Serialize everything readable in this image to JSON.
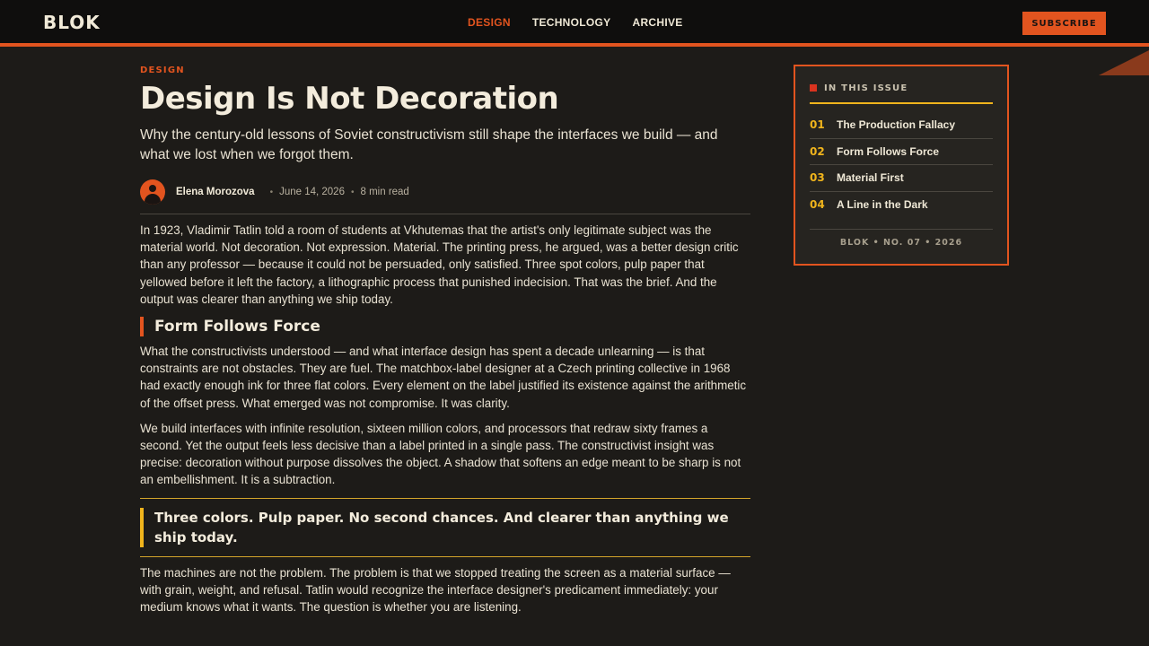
{
  "header": {
    "logo": "BLOK",
    "nav": [
      {
        "label": "DESIGN",
        "active": true
      },
      {
        "label": "TECHNOLOGY",
        "active": false
      },
      {
        "label": "ARCHIVE",
        "active": false
      }
    ],
    "subscribe_label": "SUBSCRIBE"
  },
  "article": {
    "kicker": "DESIGN",
    "title": "Design Is Not Decoration",
    "subtitle": "Why the century-old lessons of Soviet constructivism still shape the interfaces we build — and what we lost when we forgot them.",
    "author": "Elena Morozova",
    "date": "June 14, 2026",
    "read_time": "8 min read",
    "paragraph_1": "In 1923, Vladimir Tatlin told a room of students at Vkhutemas that the artist's only legitimate subject was the material world. Not decoration. Not expression. Material. The printing press, he argued, was a better design critic than any professor — because it could not be persuaded, only satisfied. Three spot colors, pulp paper that yellowed before it left the factory, a lithographic process that punished indecision. That was the brief. And the output was clearer than anything we ship today.",
    "heading_1": "Form Follows Force",
    "paragraph_2": "What the constructivists understood — and what interface design has spent a decade unlearning — is that constraints are not obstacles. They are fuel. The matchbox-label designer at a Czech printing collective in 1968 had exactly enough ink for three flat colors. Every element on the label justified its existence against the arithmetic of the offset press. What emerged was not compromise. It was clarity.",
    "paragraph_3": "We build interfaces with infinite resolution, sixteen million colors, and processors that redraw sixty frames a second. Yet the output feels less decisive than a label printed in a single pass. The constructivist insight was precise: decoration without purpose dissolves the object. A shadow that softens an edge meant to be sharp is not an embellishment. It is a subtraction.",
    "pull_quote": "Three colors. Pulp paper. No second chances. And clearer than anything we ship today.",
    "paragraph_4": "The machines are not the problem. The problem is that we stopped treating the screen as a material surface — with grain, weight, and refusal. Tatlin would recognize the interface designer's predicament immediately: your medium knows what it wants. The question is whether you are listening."
  },
  "sidebar": {
    "title": "IN THIS ISSUE",
    "items": [
      {
        "num": "01",
        "label": "The Production Fallacy"
      },
      {
        "num": "02",
        "label": "Form Follows Force"
      },
      {
        "num": "03",
        "label": "Material First"
      },
      {
        "num": "04",
        "label": "A Line in the Dark"
      }
    ],
    "footer": "BLOK • NO. 07 • 2026"
  },
  "colors": {
    "accent": "#e2541f",
    "highlight": "#f0b41c",
    "background": "#1d1b18",
    "header_bg": "#0f0e0d"
  }
}
